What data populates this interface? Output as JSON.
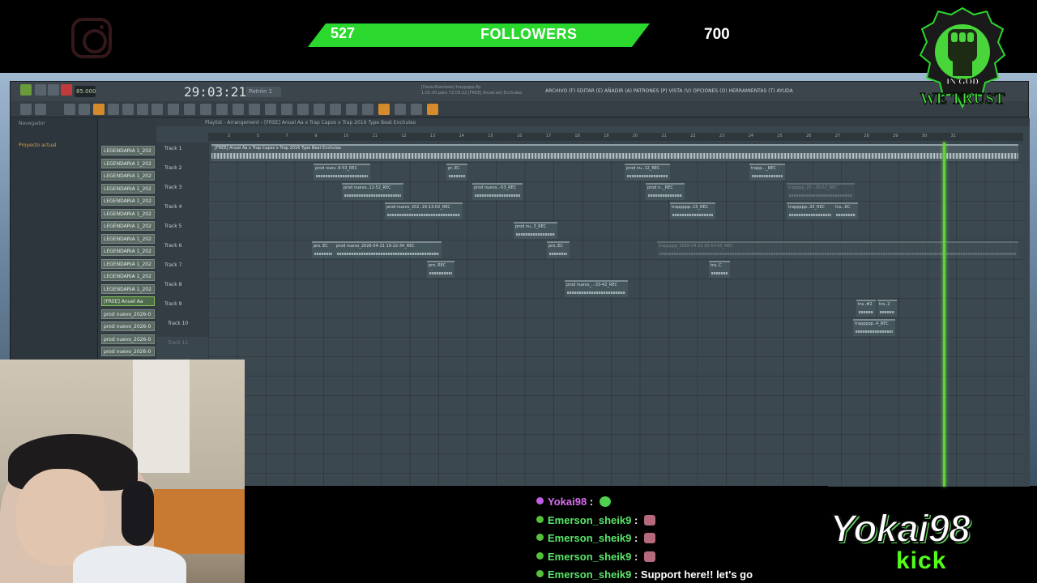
{
  "overlay": {
    "follower_count": "527",
    "follower_label": "FOLLOWERS",
    "follower_goal": "700",
    "badge_text_top": "IN GOD",
    "badge_text_bottom": "WE TRUST",
    "channel_name": "Yokai98",
    "platform": "kick",
    "accent_color": "#2bd82d"
  },
  "fl": {
    "tempo": "85.000",
    "time": "29:03:21",
    "pattern": "Patrón 1",
    "menu": "ARCHIVO (F)  EDITAR (E)  AÑADIR (A)  PATRONES (P)  VISTA (V)  OPCIONES (O)  HERRAMIENTAS (T)  AYUDA",
    "song_line1": "[DanielGamboa] trappppp.flp",
    "song_line2": "1:01:00 para 72:03:22   [FREE] Anuel.ext Enchulao",
    "playlist_title": "Playlist - Arrangement › [FREE] Anuel Aa x Trap Capos x Trap 2016 Type Beat Enchulao",
    "browser_title": "Navegador",
    "browser_item": "Proyecto actual",
    "channels": [
      "LEGENDARIA 1_202",
      "LEGENDARIA 1_202",
      "LEGENDARIA 1_202",
      "LEGENDARIA 1_202",
      "LEGENDARIA 1_202",
      "LEGENDARIA 1_202",
      "LEGENDARIA 1_202",
      "LEGENDARIA 1_202",
      "LEGENDARIA 1_202",
      "LEGENDARIA 1_202",
      "LEGENDARIA 1_202",
      "LEGENDARIA 1_202",
      "[FREE] Anuel Aa",
      "prod nuevo_2026-0",
      "prod nuevo_2026-0",
      "prod nuevo_2026-0",
      "prod nuevo_2026-0"
    ],
    "tracks": [
      "Track 1",
      "Track 2",
      "Track 3",
      "Track 4",
      "Track 5",
      "Track 6",
      "Track 7",
      "Track 8",
      "Track 9",
      "Track 10",
      "Track 11"
    ],
    "ruler": [
      "3",
      "5",
      "7",
      "9",
      "10",
      "11",
      "12",
      "13",
      "14",
      "15",
      "16",
      "17",
      "18",
      "19",
      "20",
      "21",
      "22",
      "23",
      "24",
      "25",
      "26",
      "27",
      "28",
      "29",
      "30",
      "31"
    ],
    "main_audio": "[FREE] Anuel Aa x Trap Capos x Trap 2016 Type Beat Enchulao",
    "clips": [
      "prod nuev..9-53_REC",
      "pr..EC",
      "prod nu..12_REC",
      "trapp..._REC",
      "prod nuevo..11-52_REC",
      "prod nuevo..-03_REC",
      "prod n.._REC",
      "trapppp_20..-30-57_REC",
      "prod nuevo_202..19-13-02_REC",
      "trappppp..15_REC",
      "trappppp..33_REC",
      "tra...EC",
      "prod nu..3_REC",
      "pro..EC",
      "prod nuevo_2026-04-21 19-22-34_REC",
      "pro..EC",
      "trappppp_2026-04-22 20-54-05_REC",
      "pro..REC",
      "tra..C",
      "prod nuevo_..-33-42_REC",
      "tra..#2",
      "tra..2",
      "trappppp..4_REC"
    ]
  },
  "chat": [
    {
      "user": "Yokai98",
      "message": ""
    },
    {
      "user": "Emerson_sheik9",
      "message": ""
    },
    {
      "user": "Emerson_sheik9",
      "message": ""
    },
    {
      "user": "Emerson_sheik9",
      "message": ""
    },
    {
      "user": "Emerson_sheik9",
      "message": "Support here!! let's go"
    }
  ]
}
